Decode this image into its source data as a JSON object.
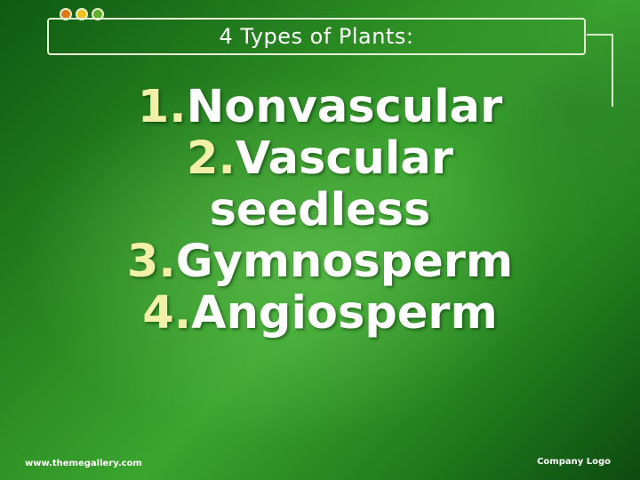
{
  "slide": {
    "title": "4 Types of Plants:",
    "items": [
      {
        "number": "1.",
        "text": "Nonvascular"
      },
      {
        "number": "2.",
        "text": "Vascular"
      },
      {
        "number": "",
        "text": "seedless"
      },
      {
        "number": "3.",
        "text": "Gymnosperm"
      },
      {
        "number": "4.",
        "text": "Angiosperm"
      }
    ],
    "footer": {
      "url": "www.themegallery.com",
      "logo_text": "Company Logo"
    },
    "colors": {
      "number": "#f2efa8",
      "text": "#ffffff",
      "dot_orange": "#e07818",
      "dot_yellow": "#f0c020",
      "dot_green": "#60b030"
    }
  }
}
